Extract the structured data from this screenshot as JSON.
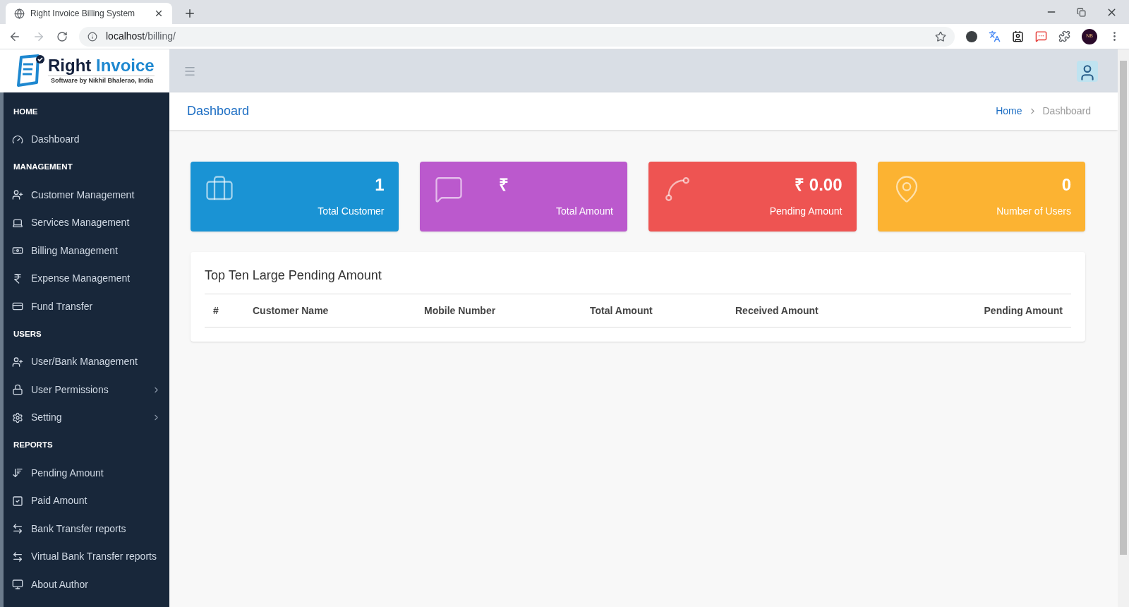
{
  "browser": {
    "tab_title": "Right Invoice Billing System",
    "url_host": "localhost",
    "url_path": "/billing/",
    "profile_initials": "NB"
  },
  "logo": {
    "title_first": "Right",
    "title_second": "Invoice",
    "subtitle": "Software by Nikhil Bhalerao, India"
  },
  "sidebar": {
    "sections": [
      {
        "title": "HOME",
        "items": [
          {
            "kind": "gauge",
            "label": "Dashboard",
            "has_submenu": false
          }
        ]
      },
      {
        "title": "MANAGEMENT",
        "items": [
          {
            "kind": "user-plus",
            "label": "Customer Management",
            "has_submenu": false
          },
          {
            "kind": "laptop",
            "label": "Services Management",
            "has_submenu": false
          },
          {
            "kind": "banknote",
            "label": "Billing Management",
            "has_submenu": false
          },
          {
            "kind": "rupee",
            "label": "Expense Management",
            "has_submenu": false
          },
          {
            "kind": "card",
            "label": "Fund Transfer",
            "has_submenu": false
          }
        ]
      },
      {
        "title": "USERS",
        "items": [
          {
            "kind": "user-plus",
            "label": "User/Bank Management",
            "has_submenu": false
          },
          {
            "kind": "lock",
            "label": "User Permissions",
            "has_submenu": true
          },
          {
            "kind": "gear",
            "label": "Setting",
            "has_submenu": true
          }
        ]
      },
      {
        "title": "REPORTS",
        "items": [
          {
            "kind": "sort",
            "label": "Pending Amount",
            "has_submenu": false
          },
          {
            "kind": "check",
            "label": "Paid Amount",
            "has_submenu": false
          },
          {
            "kind": "transfer",
            "label": "Bank Transfer reports",
            "has_submenu": false
          },
          {
            "kind": "transfer",
            "label": "Virtual Bank Transfer reports",
            "has_submenu": false
          },
          {
            "kind": "monitor",
            "label": "About Author",
            "has_submenu": false
          }
        ]
      }
    ]
  },
  "page": {
    "title": "Dashboard",
    "breadcrumb": [
      "Home",
      "Dashboard"
    ]
  },
  "cards": [
    {
      "kind": "briefcase",
      "color": "#1a93d4",
      "value": "1",
      "label": "Total Customer"
    },
    {
      "kind": "chat",
      "color": "#bb59cd",
      "value": "₹",
      "label": "Total Amount"
    },
    {
      "kind": "spline",
      "color": "#ee5452",
      "value": "₹ 0.00",
      "label": "Pending Amount"
    },
    {
      "kind": "pin",
      "color": "#fcb332",
      "value": "0",
      "label": "Number of Users"
    }
  ],
  "table": {
    "title": "Top Ten Large Pending Amount",
    "columns": [
      "#",
      "Customer Name",
      "Mobile Number",
      "Total Amount",
      "Received Amount",
      "Pending Amount"
    ]
  }
}
